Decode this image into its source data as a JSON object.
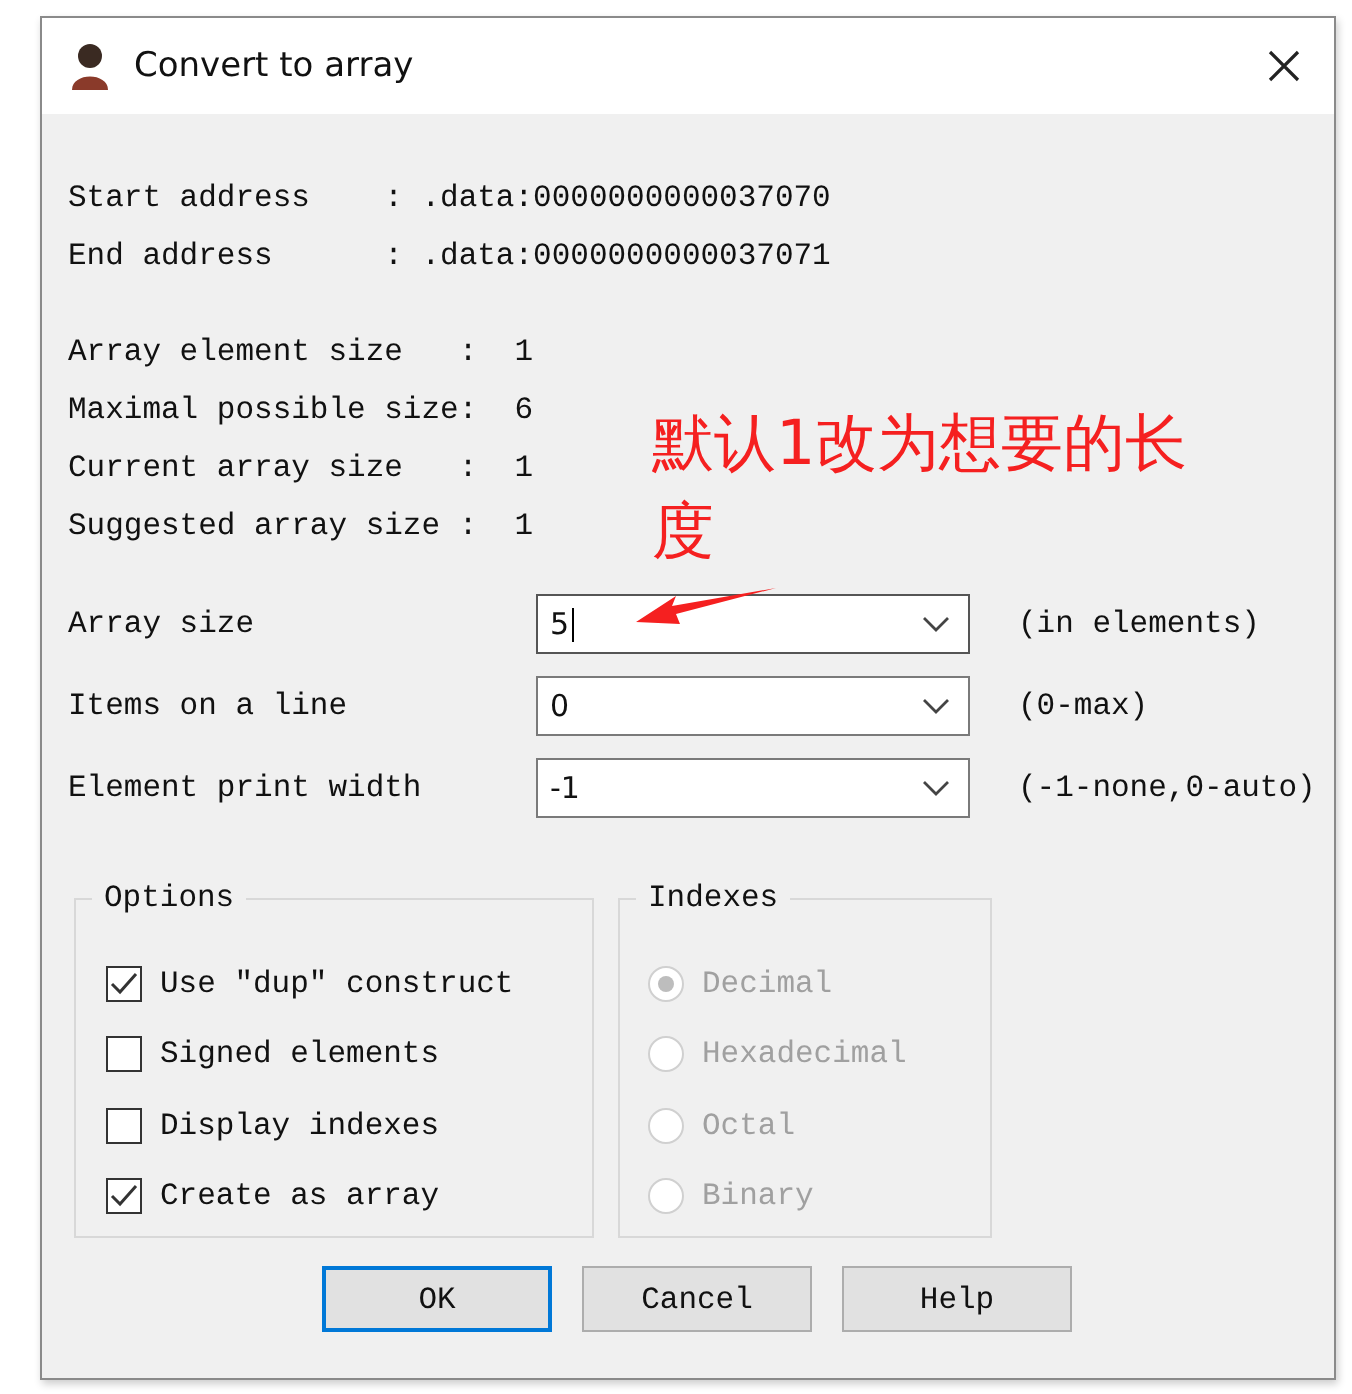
{
  "window": {
    "title": "Convert to array"
  },
  "info_sections": [
    [
      "Start address    : .data:0000000000037070",
      "End address      : .data:0000000000037071"
    ],
    [
      "Array element size   :  1",
      "Maximal possible size:  6",
      "Current array size   :  1",
      "Suggested array size :  1"
    ]
  ],
  "fields": [
    {
      "label": "Array size",
      "value": "5",
      "hint": "(in elements)",
      "focused": true
    },
    {
      "label": "Items on a line",
      "value": "0",
      "hint": "(0-max)",
      "focused": false
    },
    {
      "label": "Element print width",
      "value": "-1",
      "hint": "(-1-none,0-auto)",
      "focused": false
    }
  ],
  "options": {
    "title": "Options",
    "items": [
      {
        "label": "Use \"dup\" construct",
        "checked": true
      },
      {
        "label": "Signed elements",
        "checked": false
      },
      {
        "label": "Display indexes",
        "checked": false
      },
      {
        "label": "Create as array",
        "checked": true
      }
    ]
  },
  "indexes": {
    "title": "Indexes",
    "disabled": true,
    "items": [
      {
        "label": "Decimal",
        "selected": true
      },
      {
        "label": "Hexadecimal",
        "selected": false
      },
      {
        "label": "Octal",
        "selected": false
      },
      {
        "label": "Binary",
        "selected": false
      }
    ]
  },
  "buttons": [
    {
      "label": "OK",
      "default": true
    },
    {
      "label": "Cancel",
      "default": false
    },
    {
      "label": "Help",
      "default": false
    }
  ],
  "annotation": {
    "text": "默认1改为想要的长度"
  }
}
